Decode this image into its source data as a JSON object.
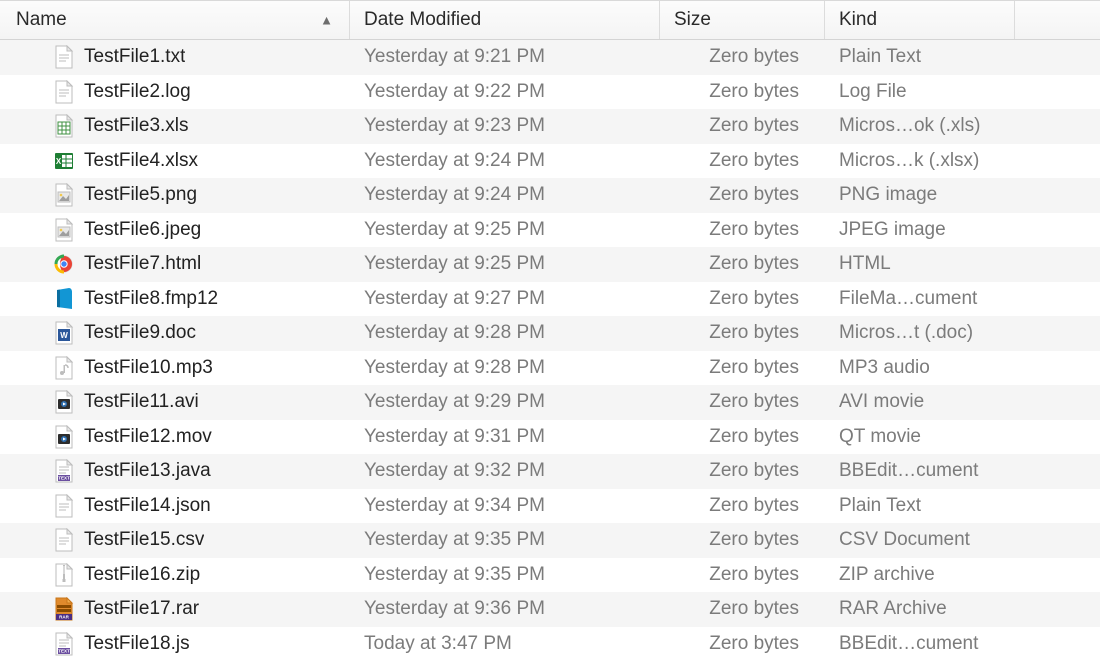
{
  "columns": {
    "name": "Name",
    "date": "Date Modified",
    "size": "Size",
    "kind": "Kind"
  },
  "sort": {
    "column": "name",
    "direction": "asc"
  },
  "files": [
    {
      "name": "TestFile1.txt",
      "date": "Yesterday at 9:21 PM",
      "size": "Zero bytes",
      "kind": "Plain Text",
      "icon": "txt"
    },
    {
      "name": "TestFile2.log",
      "date": "Yesterday at 9:22 PM",
      "size": "Zero bytes",
      "kind": "Log File",
      "icon": "txt"
    },
    {
      "name": "TestFile3.xls",
      "date": "Yesterday at 9:23 PM",
      "size": "Zero bytes",
      "kind": "Micros…ok (.xls)",
      "icon": "xls"
    },
    {
      "name": "TestFile4.xlsx",
      "date": "Yesterday at 9:24 PM",
      "size": "Zero bytes",
      "kind": "Micros…k (.xlsx)",
      "icon": "xlsx"
    },
    {
      "name": "TestFile5.png",
      "date": "Yesterday at 9:24 PM",
      "size": "Zero bytes",
      "kind": "PNG image",
      "icon": "img"
    },
    {
      "name": "TestFile6.jpeg",
      "date": "Yesterday at 9:25 PM",
      "size": "Zero bytes",
      "kind": "JPEG image",
      "icon": "img"
    },
    {
      "name": "TestFile7.html",
      "date": "Yesterday at 9:25 PM",
      "size": "Zero bytes",
      "kind": "HTML",
      "icon": "html"
    },
    {
      "name": "TestFile8.fmp12",
      "date": "Yesterday at 9:27 PM",
      "size": "Zero bytes",
      "kind": "FileMa…cument",
      "icon": "fmp"
    },
    {
      "name": "TestFile9.doc",
      "date": "Yesterday at 9:28 PM",
      "size": "Zero bytes",
      "kind": "Micros…t (.doc)",
      "icon": "doc"
    },
    {
      "name": "TestFile10.mp3",
      "date": "Yesterday at 9:28 PM",
      "size": "Zero bytes",
      "kind": "MP3 audio",
      "icon": "audio"
    },
    {
      "name": "TestFile11.avi",
      "date": "Yesterday at 9:29 PM",
      "size": "Zero bytes",
      "kind": "AVI movie",
      "icon": "video"
    },
    {
      "name": "TestFile12.mov",
      "date": "Yesterday at 9:31 PM",
      "size": "Zero bytes",
      "kind": "QT movie",
      "icon": "video"
    },
    {
      "name": "TestFile13.java",
      "date": "Yesterday at 9:32 PM",
      "size": "Zero bytes",
      "kind": "BBEdit…cument",
      "icon": "bbedit"
    },
    {
      "name": "TestFile14.json",
      "date": "Yesterday at 9:34 PM",
      "size": "Zero bytes",
      "kind": "Plain Text",
      "icon": "txt"
    },
    {
      "name": "TestFile15.csv",
      "date": "Yesterday at 9:35 PM",
      "size": "Zero bytes",
      "kind": "CSV Document",
      "icon": "txt"
    },
    {
      "name": "TestFile16.zip",
      "date": "Yesterday at 9:35 PM",
      "size": "Zero bytes",
      "kind": "ZIP archive",
      "icon": "zip"
    },
    {
      "name": "TestFile17.rar",
      "date": "Yesterday at 9:36 PM",
      "size": "Zero bytes",
      "kind": "RAR Archive",
      "icon": "rar"
    },
    {
      "name": "TestFile18.js",
      "date": "Today at 3:47 PM",
      "size": "Zero bytes",
      "kind": "BBEdit…cument",
      "icon": "bbedit"
    }
  ]
}
